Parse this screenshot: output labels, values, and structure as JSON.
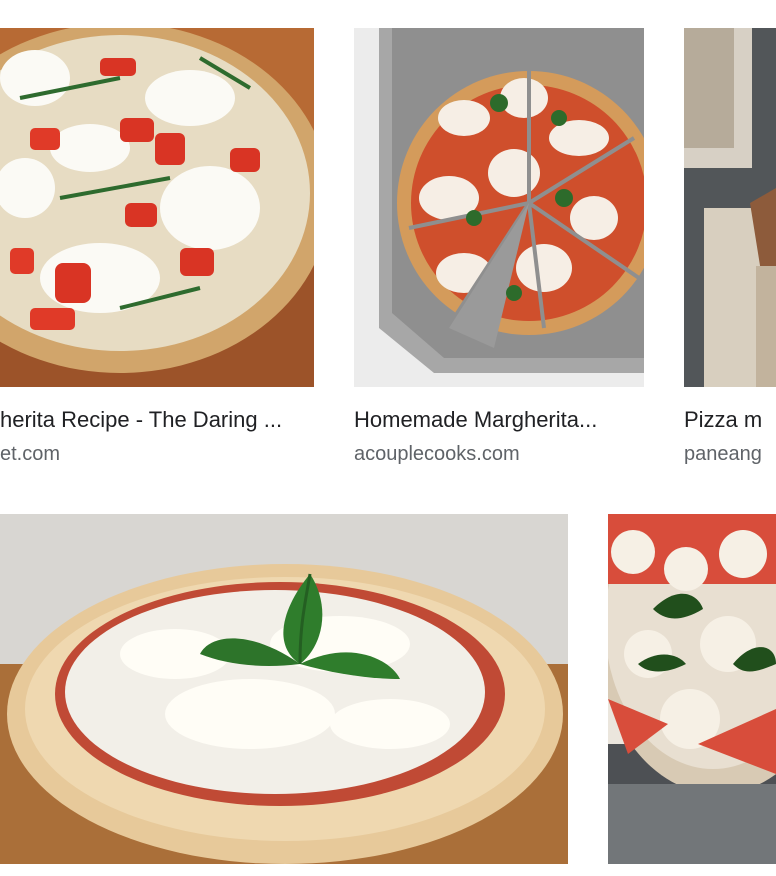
{
  "results": [
    {
      "title": "herita Recipe - The Daring ...",
      "source": "et.com",
      "image": "pizza-with-tomato-basil-mozzarella"
    },
    {
      "title": "Homemade Margherita...",
      "source": "acouplecooks.com",
      "image": "sliced-margherita-pizza-on-peel"
    },
    {
      "title": "Pizza m",
      "source": "paneang",
      "image": "pizza-on-wooden-board"
    },
    {
      "image": "margherita-pizza-with-basil-leaf"
    },
    {
      "image": "close-up-margherita-pizza"
    }
  ],
  "colors": {
    "title_text": "#202124",
    "source_text": "#5f6368",
    "background": "#ffffff"
  }
}
